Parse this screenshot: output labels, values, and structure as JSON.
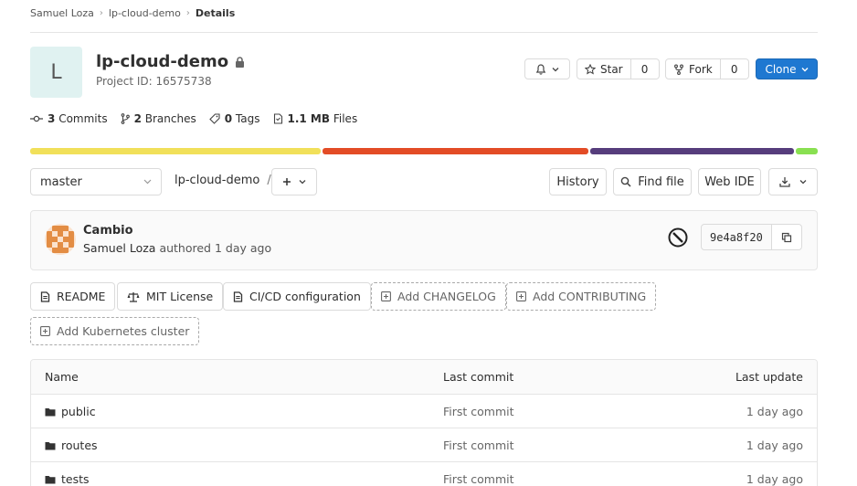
{
  "breadcrumb": {
    "owner": "Samuel Loza",
    "project": "lp-cloud-demo",
    "current": "Details"
  },
  "project": {
    "avatar_letter": "L",
    "name": "lp-cloud-demo",
    "id_text": "Project ID: 16575738"
  },
  "actions": {
    "star_label": "Star",
    "star_count": "0",
    "fork_label": "Fork",
    "fork_count": "0",
    "clone_label": "Clone"
  },
  "stats": {
    "commits_count": "3",
    "commits_label": "Commits",
    "branches_count": "2",
    "branches_label": "Branches",
    "tags_count": "0",
    "tags_label": "Tags",
    "files_size": "1.1 MB",
    "files_label": "Files"
  },
  "languages": [
    {
      "color": "#f1e05a",
      "share": 37.2
    },
    {
      "color": "#e34c26",
      "share": 33.9
    },
    {
      "color": "#563d7c",
      "share": 26.1
    },
    {
      "color": "#89e051",
      "share": 2.8
    }
  ],
  "toolbar": {
    "branch": "master",
    "path": "lp-cloud-demo",
    "slash": "/",
    "history": "History",
    "find_file": "Find file",
    "web_ide": "Web IDE"
  },
  "commit": {
    "title": "Cambio",
    "author": "Samuel Loza",
    "authored": "authored",
    "time": "1 day ago",
    "sha": "9e4a8f20",
    "avatar_colors": [
      "#e38d44",
      "#fbe3cf"
    ]
  },
  "quick_actions": {
    "readme": "README",
    "license": "MIT License",
    "cicd": "CI/CD configuration",
    "changelog": "Add CHANGELOG",
    "contributing": "Add CONTRIBUTING",
    "kubernetes": "Add Kubernetes cluster"
  },
  "table": {
    "headers": {
      "name": "Name",
      "last_commit": "Last commit",
      "last_update": "Last update"
    },
    "rows": [
      {
        "name": "public",
        "commit": "First commit",
        "updated": "1 day ago"
      },
      {
        "name": "routes",
        "commit": "First commit",
        "updated": "1 day ago"
      },
      {
        "name": "tests",
        "commit": "First commit",
        "updated": "1 day ago"
      }
    ]
  }
}
